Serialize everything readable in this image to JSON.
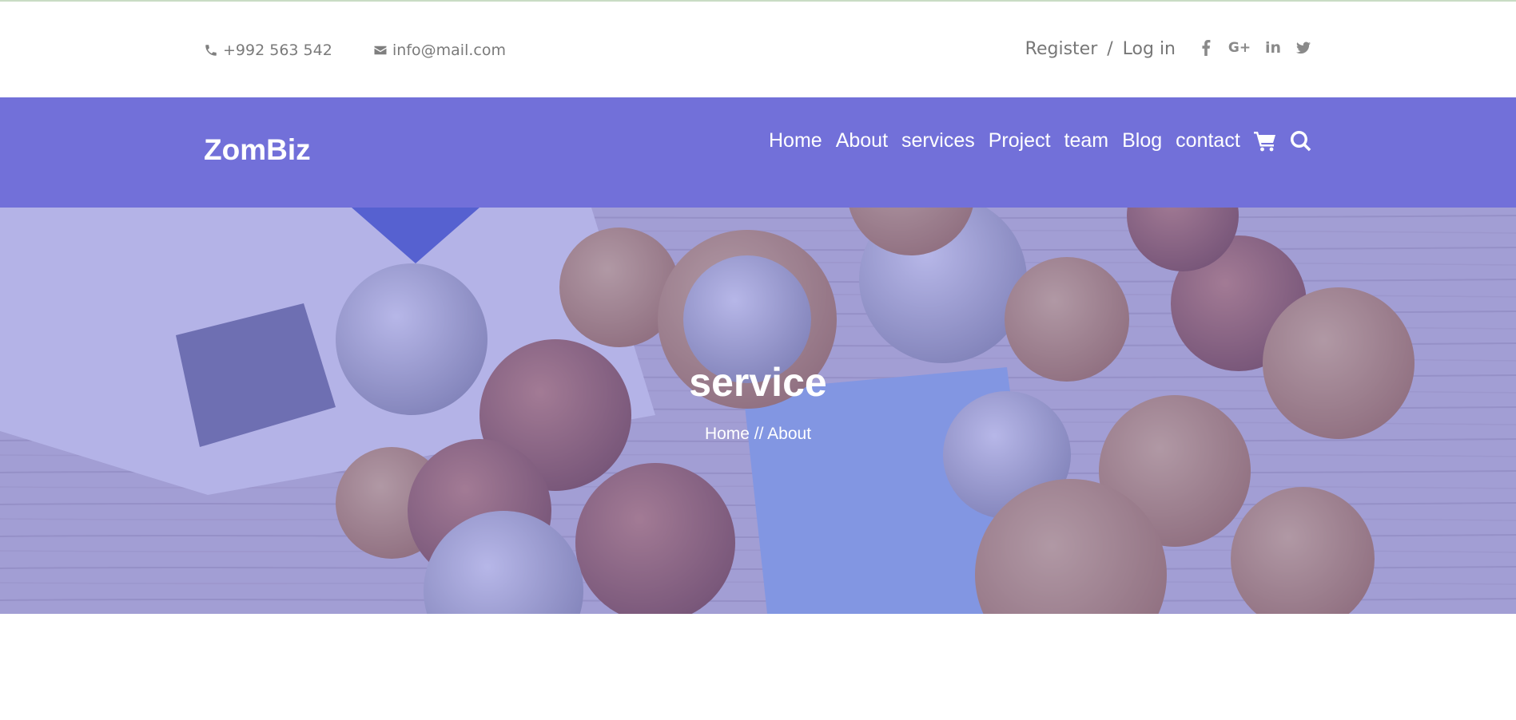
{
  "topbar": {
    "phone": "+992 563 542",
    "email": "info@mail.com",
    "register": "Register",
    "separator": "/",
    "login": "Log in",
    "social_icons": [
      "facebook-icon",
      "google-plus-icon",
      "linkedin-icon",
      "twitter-icon"
    ],
    "google_plus_text": "G+",
    "linkedin_text": "in"
  },
  "navbar": {
    "brand": "ZomBiz",
    "items": [
      {
        "label": "Home"
      },
      {
        "label": "About"
      },
      {
        "label": "services"
      },
      {
        "label": "Project"
      },
      {
        "label": "team"
      },
      {
        "label": "Blog"
      },
      {
        "label": "contact"
      }
    ],
    "icons": [
      "cart-icon",
      "search-icon"
    ],
    "background": "#7270d9"
  },
  "hero": {
    "title": "service",
    "breadcrumb": "Home // About"
  }
}
